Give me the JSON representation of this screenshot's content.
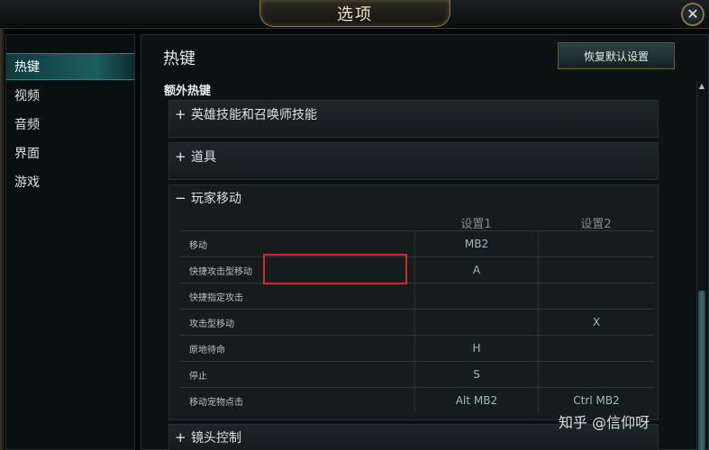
{
  "window": {
    "title": "选项",
    "close_glyph": "✕"
  },
  "sidebar": {
    "items": [
      {
        "label": "热键",
        "active": true
      },
      {
        "label": "视频"
      },
      {
        "label": "音频"
      },
      {
        "label": "界面"
      },
      {
        "label": "游戏"
      }
    ]
  },
  "main": {
    "title": "热键",
    "restore_button": "恢复默认设置",
    "section_label": "额外热键",
    "groups": [
      {
        "sign": "+",
        "label": "英雄技能和召唤师技能"
      },
      {
        "sign": "+",
        "label": "道具"
      }
    ],
    "expanded_group": {
      "sign": "−",
      "label": "玩家移动",
      "columns": [
        "设置1",
        "设置2"
      ],
      "rows": [
        {
          "label": "移动",
          "set1": "MB2",
          "set2": ""
        },
        {
          "label": "快捷攻击型移动",
          "set1": "A",
          "set2": ""
        },
        {
          "label": "快捷指定攻击",
          "set1": "",
          "set2": ""
        },
        {
          "label": "攻击型移动",
          "set1": "",
          "set2": "X"
        },
        {
          "label": "原地待命",
          "set1": "H",
          "set2": ""
        },
        {
          "label": "停止",
          "set1": "S",
          "set2": ""
        },
        {
          "label": "移动宠物点击",
          "set1": "Alt  MB2",
          "set2": "Ctrl  MB2"
        }
      ]
    },
    "bottom_group": {
      "sign": "+",
      "label": "镜头控制"
    }
  },
  "scrollbar": {
    "up_glyph": "▲"
  },
  "watermark": "知乎 @信仰呀",
  "colors": {
    "accent": "#1d5e60",
    "highlight": "#d9262b",
    "gold_border": "#8a7443"
  }
}
